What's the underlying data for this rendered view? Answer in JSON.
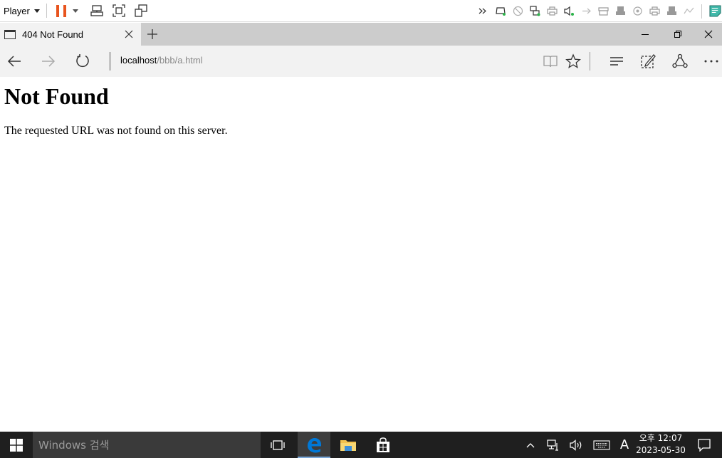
{
  "vm_toolbar": {
    "menu_label": "Player",
    "left_icons": [
      "pause-icon",
      "send-ctrl-alt-del-icon",
      "fullscreen-icon",
      "unity-icon"
    ],
    "device_icons": [
      "more-devices-icon",
      "hard-disk-icon",
      "cd-dvd-icon",
      "network-adapter-icon",
      "printer-icon",
      "sound-card-icon",
      "usb-icon",
      "floppy-icon",
      "usb-drive-icon",
      "camera-icon",
      "printer2-icon",
      "usb-drive2-icon",
      "usb-device-icon",
      "message-icon"
    ],
    "pause_color": "#e8541e"
  },
  "browser": {
    "tab_title": "404 Not Found",
    "url_host": "localhost",
    "url_path": "/bbb/a.html"
  },
  "page": {
    "heading": "Not Found",
    "message": "The requested URL was not found on this server."
  },
  "taskbar": {
    "search_placeholder": "Windows 검색",
    "time": "오후 12:07",
    "date": "2023-05-30",
    "ime_label": "A",
    "edge_color": "#0078d7"
  }
}
